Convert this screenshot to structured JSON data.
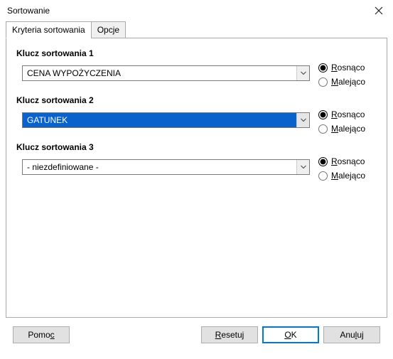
{
  "window": {
    "title": "Sortowanie"
  },
  "tabs": {
    "criteria": "Kryteria sortowania",
    "options": "Opcje"
  },
  "groups": {
    "k1": {
      "label": "Klucz sortowania 1",
      "value": "CENA WYPOŻYCZENIA",
      "ascending": true
    },
    "k2": {
      "label": "Klucz sortowania 2",
      "value": "GATUNEK",
      "ascending": true
    },
    "k3": {
      "label": "Klucz sortowania 3",
      "value": "- niezdefiniowane -",
      "ascending": true
    }
  },
  "radio_labels": {
    "asc_pre": "R",
    "asc_post": "osnąco",
    "desc_pre": "M",
    "desc_post": "alejąco"
  },
  "buttons": {
    "help_pre": "Pomo",
    "help_u": "c",
    "help_post": "",
    "reset_pre": "",
    "reset_u": "R",
    "reset_post": "esetuj",
    "ok_pre": "",
    "ok_u": "O",
    "ok_post": "K",
    "cancel_pre": "Anu",
    "cancel_u": "l",
    "cancel_post": "uj"
  }
}
